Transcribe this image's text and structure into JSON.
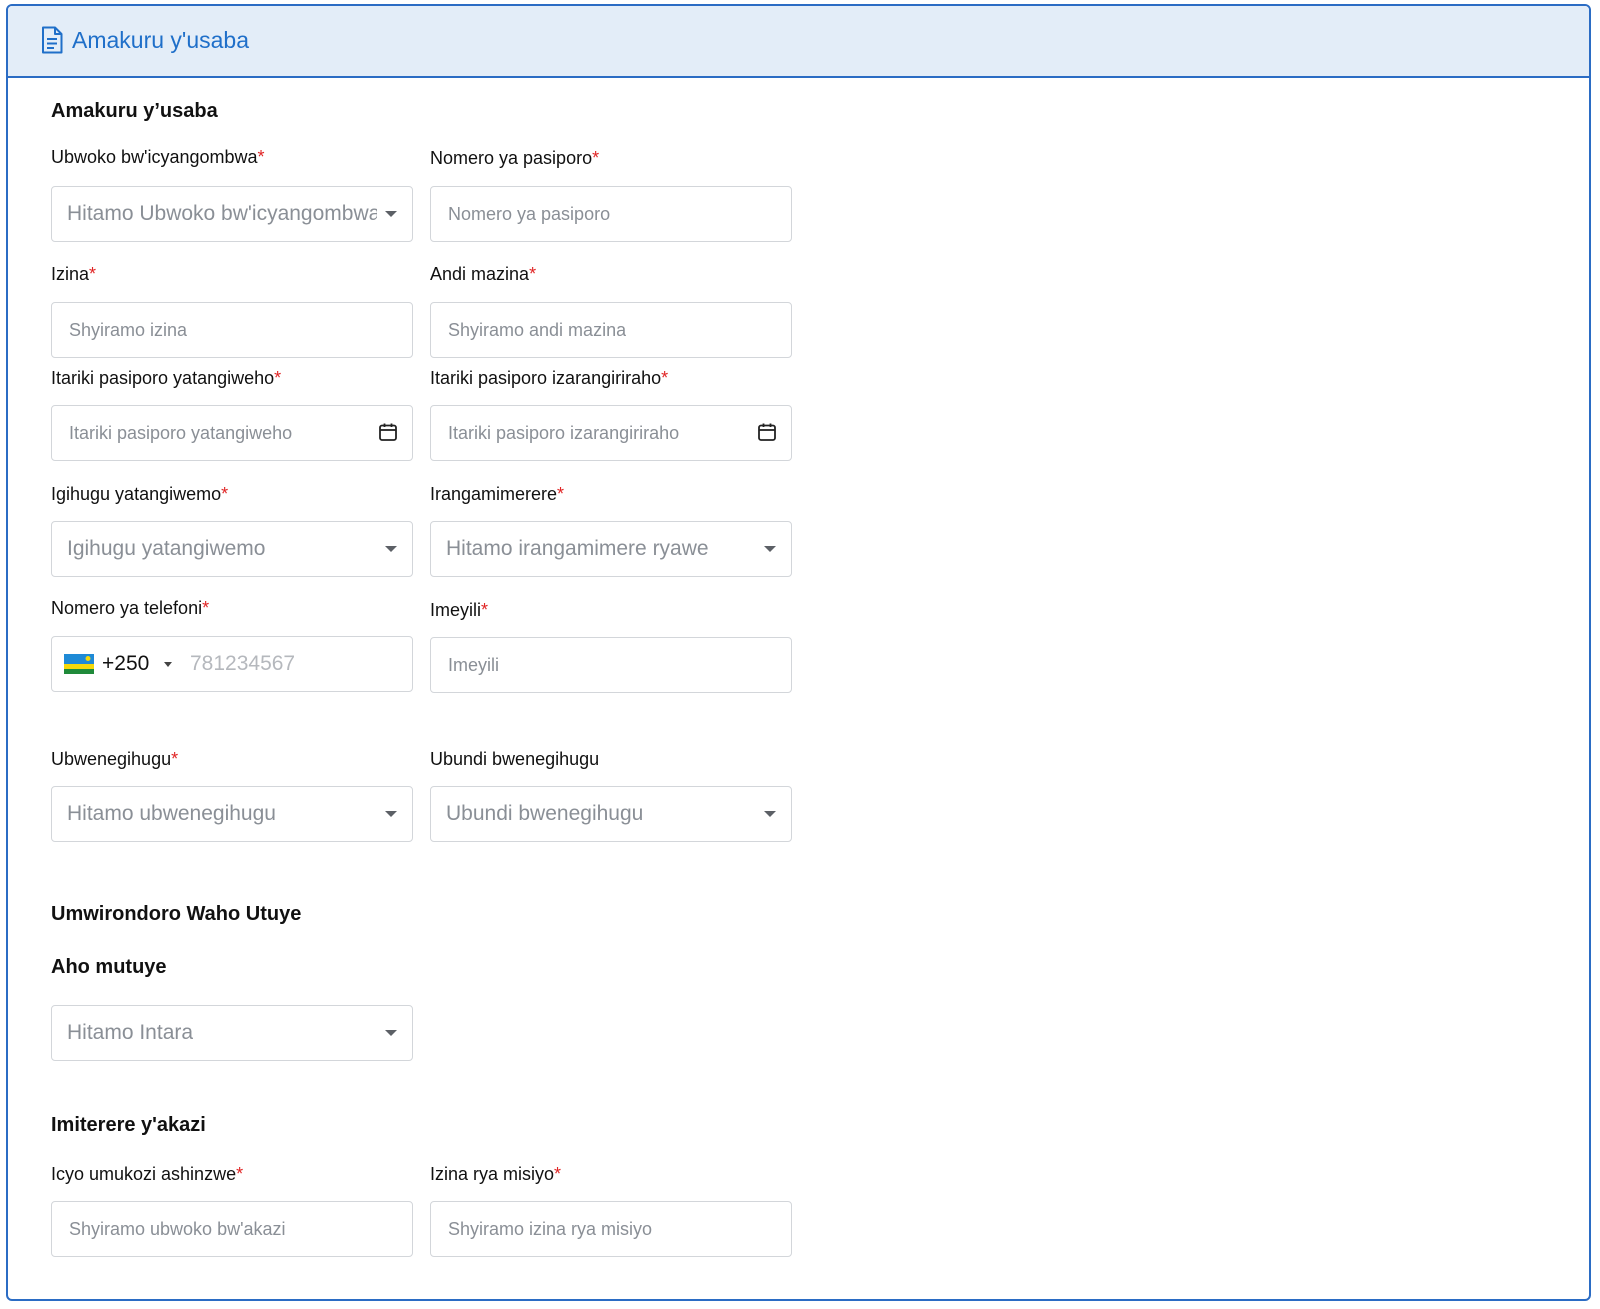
{
  "header": {
    "title": "Amakuru y'usaba",
    "icon": "document-icon"
  },
  "sections": {
    "applicant": "Amakuru y’usaba",
    "address": "Umwirondoro Waho Utuye",
    "residence": "Aho mutuye",
    "work": "Imiterere y'akazi"
  },
  "fields": {
    "permit_type": {
      "label": "Ubwoko bw'icyangombwa",
      "placeholder": "Hitamo Ubwoko bw'icyangombwa"
    },
    "passport_number": {
      "label": "Nomero ya pasiporo",
      "placeholder": "Nomero ya pasiporo"
    },
    "first_name": {
      "label": "Izina",
      "placeholder": "Shyiramo izina"
    },
    "other_names": {
      "label": "Andi mazina",
      "placeholder": "Shyiramo andi mazina"
    },
    "passport_issue_date": {
      "label": "Itariki pasiporo yatangiweho",
      "placeholder": "Itariki pasiporo yatangiweho"
    },
    "passport_expiry_date": {
      "label": "Itariki pasiporo izarangiriraho",
      "placeholder": "Itariki pasiporo izarangiriraho"
    },
    "issuing_country": {
      "label": "Igihugu yatangiwemo",
      "placeholder": "Igihugu yatangiwemo"
    },
    "gender": {
      "label": "Irangamimerere",
      "placeholder": "Hitamo irangamimere ryawe"
    },
    "phone": {
      "label": "Nomero ya telefoni",
      "country_code": "+250",
      "placeholder": "781234567"
    },
    "email": {
      "label": "Imeyili",
      "placeholder": "Imeyili"
    },
    "nationality": {
      "label": "Ubwenegihugu",
      "placeholder": "Hitamo ubwenegihugu"
    },
    "other_nationality": {
      "label": "Ubundi bwenegihugu",
      "placeholder": "Ubundi bwenegihugu"
    },
    "province": {
      "placeholder": "Hitamo Intara"
    },
    "occupation": {
      "label": "Icyo umukozi ashinzwe",
      "placeholder": "Shyiramo ubwoko bw'akazi"
    },
    "mission_name": {
      "label": "Izina rya misiyo",
      "placeholder": "Shyiramo izina rya misiyo"
    }
  },
  "required_marker": "*",
  "colors": {
    "accent": "#2b6cc4",
    "header_bg": "#e3edf8",
    "required": "#e02424",
    "border": "#d3d6da"
  }
}
